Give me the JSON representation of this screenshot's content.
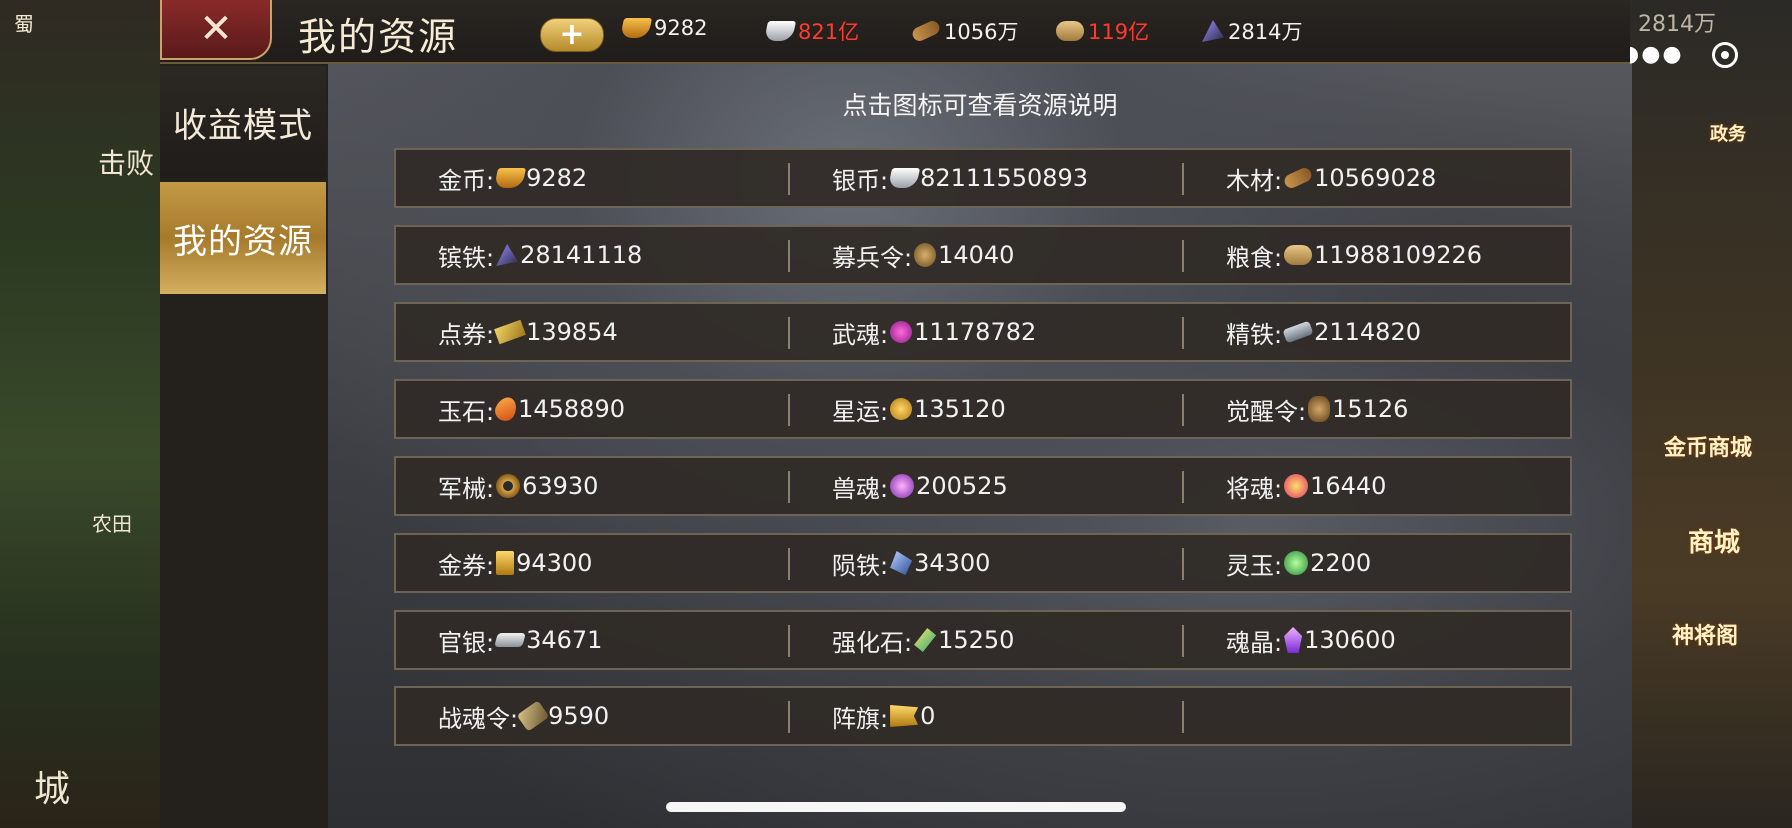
{
  "window": {
    "title": "我的资源"
  },
  "topbar": {
    "close_icon": "close-icon",
    "plus_label": "+",
    "resources": [
      {
        "icon": "gold-ingot-icon",
        "value": "9282",
        "red": false
      },
      {
        "icon": "silver-ingot-icon",
        "value": "821亿",
        "red": true
      },
      {
        "icon": "wood-icon",
        "value": "1056万",
        "red": false
      },
      {
        "icon": "grain-icon",
        "value": "119亿",
        "red": true
      },
      {
        "icon": "iron-icon",
        "value": "2814万",
        "red": false
      }
    ],
    "right_value": "2814万"
  },
  "sidebar": {
    "items": [
      {
        "label": "收益模式",
        "active": false
      },
      {
        "label": "我的资源",
        "active": true
      }
    ]
  },
  "main": {
    "hint": "点击图标可查看资源说明",
    "rows": [
      [
        {
          "label": "金币:",
          "icon": "ingot",
          "value": "9282"
        },
        {
          "label": "银币:",
          "icon": "silver",
          "value": "82111550893"
        },
        {
          "label": "木材:",
          "icon": "wood",
          "value": "10569028"
        }
      ],
      [
        {
          "label": "镔铁:",
          "icon": "iron",
          "value": "28141118"
        },
        {
          "label": "募兵令:",
          "icon": "token",
          "value": "14040"
        },
        {
          "label": "粮食:",
          "icon": "grain",
          "value": "11988109226"
        }
      ],
      [
        {
          "label": "点券:",
          "icon": "ticket",
          "value": "139854"
        },
        {
          "label": "武魂:",
          "icon": "purple",
          "value": "11178782"
        },
        {
          "label": "精铁:",
          "icon": "steel",
          "value": "2114820"
        }
      ],
      [
        {
          "label": "玉石:",
          "icon": "jade",
          "value": "1458890"
        },
        {
          "label": "星运:",
          "icon": "star",
          "value": "135120"
        },
        {
          "label": "觉醒令:",
          "icon": "awaken",
          "value": "15126"
        }
      ],
      [
        {
          "label": "军械:",
          "icon": "gear",
          "value": "63930"
        },
        {
          "label": "兽魂:",
          "icon": "beast",
          "value": "200525"
        },
        {
          "label": "将魂:",
          "icon": "general",
          "value": "16440"
        }
      ],
      [
        {
          "label": "金券:",
          "icon": "goldtkt",
          "value": "94300"
        },
        {
          "label": "陨铁:",
          "icon": "meteor",
          "value": "34300"
        },
        {
          "label": "灵玉:",
          "icon": "lingyu",
          "value": "2200"
        }
      ],
      [
        {
          "label": "官银:",
          "icon": "offsilver",
          "value": "34671"
        },
        {
          "label": "强化石:",
          "icon": "strong",
          "value": "15250"
        },
        {
          "label": "魂晶:",
          "icon": "crystal",
          "value": "130600"
        }
      ],
      [
        {
          "label": "战魂令:",
          "icon": "warsoul",
          "value": "9590"
        },
        {
          "label": "阵旗:",
          "icon": "flag",
          "value": "0"
        },
        {
          "label": "",
          "icon": "",
          "value": ""
        }
      ]
    ]
  },
  "background_hud": {
    "left_defeat": "击败",
    "left_farm": "农田",
    "left_city": "城",
    "left_shu": "蜀",
    "right_affairs": "政务",
    "right_gold_shop": "金币商城",
    "right_shop": "商城",
    "right_pavilion": "神将阁"
  },
  "colors": {
    "accent_gold": "#c39a45",
    "negative_red": "#ff3b30"
  }
}
